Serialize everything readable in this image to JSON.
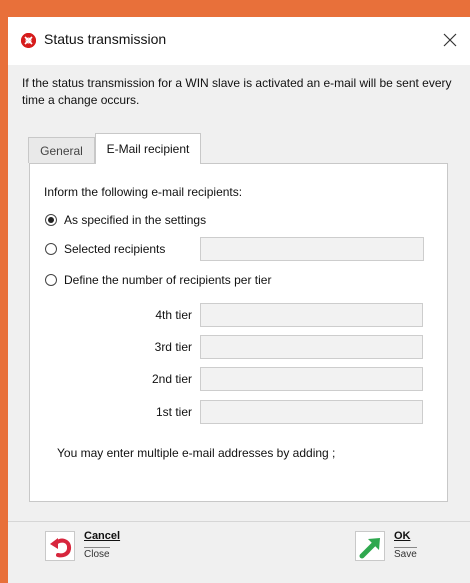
{
  "window": {
    "title": "Status transmission",
    "close_glyph": "×"
  },
  "description": "If the status transmission for a WIN slave is activated an e-mail will be sent every time a change occurs.",
  "tabs": [
    {
      "label": "General",
      "active": false
    },
    {
      "label": "E-Mail recipient",
      "active": true
    }
  ],
  "panel": {
    "heading": "Inform the following e-mail recipients:",
    "options": [
      {
        "label": "As specified in the settings",
        "checked": true
      },
      {
        "label": "Selected recipients",
        "checked": false
      },
      {
        "label": "Define the number of recipients per tier",
        "checked": false
      }
    ],
    "selected_recipients_value": "",
    "tiers": [
      {
        "label": "4th tier",
        "value": ""
      },
      {
        "label": "3rd tier",
        "value": ""
      },
      {
        "label": "2nd tier",
        "value": ""
      },
      {
        "label": "1st tier",
        "value": ""
      }
    ],
    "hint": "You may enter multiple e-mail addresses by adding ;"
  },
  "footer": {
    "cancel": {
      "label": "Cancel",
      "sub": "Close",
      "icon": "undo-arrow-icon"
    },
    "ok": {
      "label": "OK",
      "sub": "Save",
      "icon": "green-check-arrow-icon"
    }
  },
  "colors": {
    "frame_accent": "#e8703a",
    "title_icon": "#d61c1c",
    "cancel_icon": "#d7263d",
    "ok_icon": "#2fa84f"
  }
}
